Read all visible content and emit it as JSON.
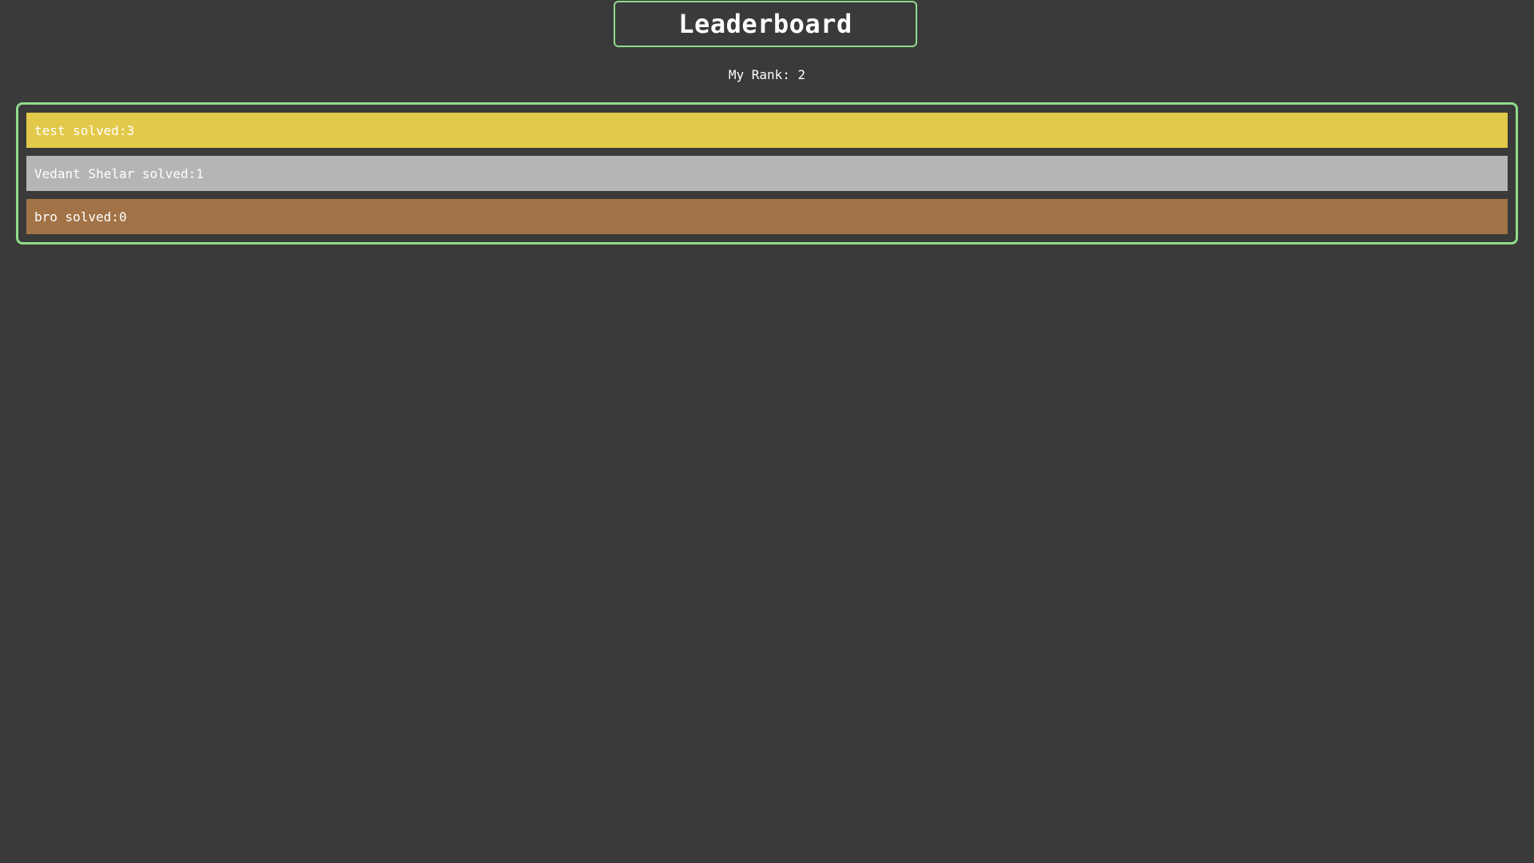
{
  "header": {
    "title": "Leaderboard",
    "rank_label": "My Rank:",
    "rank_value": "2"
  },
  "leaderboard": {
    "entries": [
      {
        "name": "test",
        "solved_label": "solved:",
        "solved": "3",
        "color": "#e3c94a"
      },
      {
        "name": "Vedant Shelar",
        "solved_label": "solved:",
        "solved": "1",
        "color": "#b5b5b5"
      },
      {
        "name": "bro",
        "solved_label": "solved:",
        "solved": "0",
        "color": "#a27346"
      }
    ]
  },
  "colors": {
    "background": "#3a3a3a",
    "accent_border": "#8fdc8c",
    "text": "#ffffff"
  }
}
